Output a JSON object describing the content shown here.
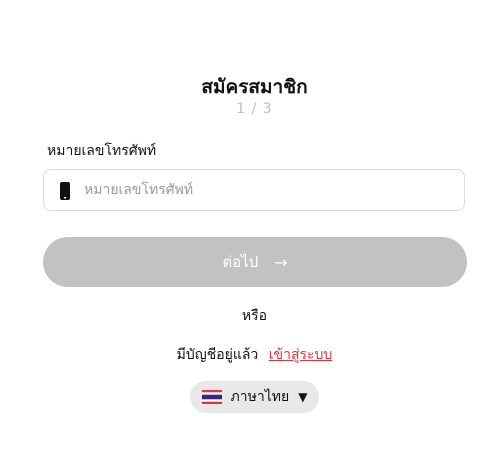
{
  "header": {
    "title": "สมัครสมาชิก",
    "step": "1 / 3"
  },
  "phone": {
    "label": "หมายเลขโทรศัพท์",
    "placeholder": "หมายเลขโทรศัพท์",
    "value": ""
  },
  "next_button": {
    "label": "ต่อไป",
    "arrow": "→"
  },
  "or_text": "หรือ",
  "login": {
    "prompt": "มีบัญชีอยู่แล้ว",
    "link": "เข้าสู่ระบบ"
  },
  "language": {
    "label": "ภาษาไทย",
    "caret": "▼",
    "flag_icon": "thailand-flag-icon"
  },
  "colors": {
    "button_disabled": "#c2c2c2",
    "link": "#d9363e",
    "field_border": "#dcdcdc",
    "language_pill": "#e8e8e8"
  }
}
